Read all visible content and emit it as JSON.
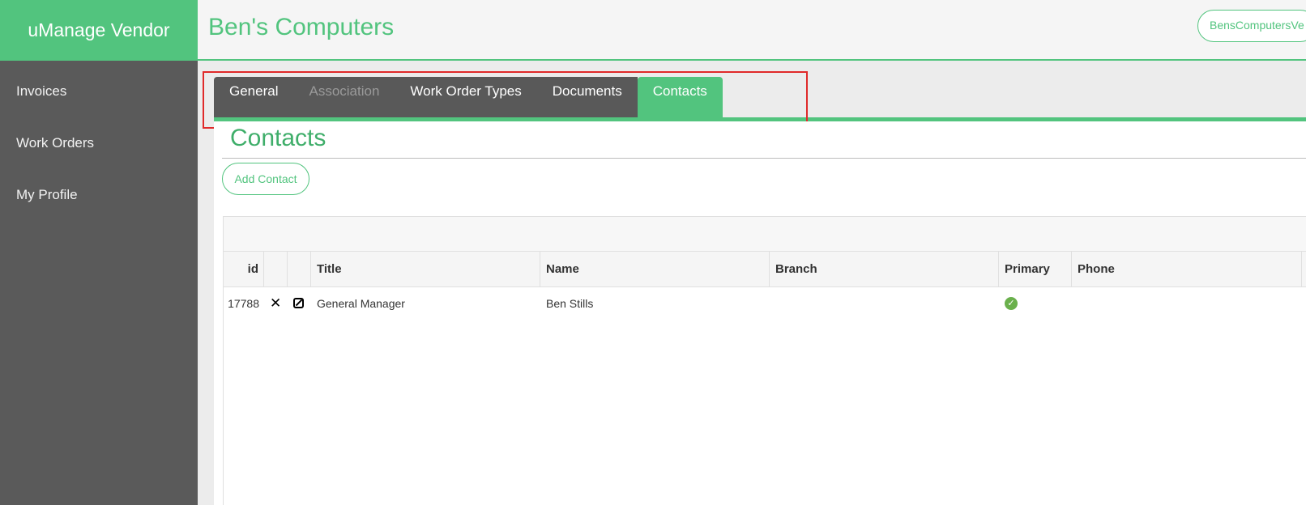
{
  "app": {
    "brand": "uManage Vendor"
  },
  "sidebar": {
    "items": [
      {
        "label": "Invoices"
      },
      {
        "label": "Work Orders"
      },
      {
        "label": "My Profile"
      }
    ]
  },
  "header": {
    "title": "Ben's Computers",
    "user": "BensComputersVe"
  },
  "tabs": [
    {
      "label": "General",
      "state": "normal"
    },
    {
      "label": "Association",
      "state": "disabled"
    },
    {
      "label": "Work Order Types",
      "state": "normal"
    },
    {
      "label": "Documents",
      "state": "normal"
    },
    {
      "label": "Contacts",
      "state": "active"
    }
  ],
  "section": {
    "title": "Contacts",
    "add_button": "Add Contact"
  },
  "table": {
    "columns": [
      "id",
      "",
      "",
      "Title",
      "Name",
      "Branch",
      "Primary",
      "Phone"
    ],
    "rows": [
      {
        "id": "17788",
        "title": "General Manager",
        "name": "Ben Stills",
        "branch": "",
        "primary": true,
        "phone": ""
      }
    ]
  },
  "colors": {
    "accent": "#52c47e",
    "sidebar": "#5a5a5a",
    "highlight": "#e02a2a"
  },
  "icons": {
    "delete": "close-icon",
    "edit": "edit-icon",
    "primary": "check-circle-icon"
  }
}
